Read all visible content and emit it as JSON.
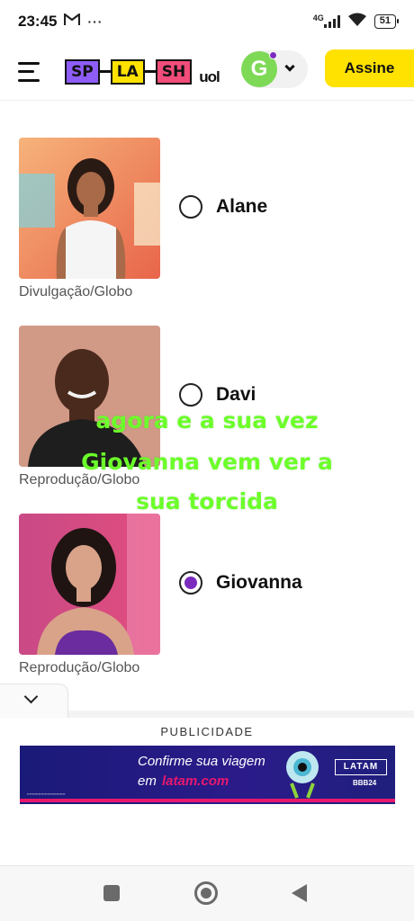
{
  "status_bar": {
    "time": "23:45",
    "notification_icons": [
      "gmail-icon",
      "more-dots-icon"
    ],
    "dots": "···",
    "network": "4G",
    "battery": "51"
  },
  "header": {
    "logo_blocks": [
      {
        "text": "SP",
        "color": "#8e5cf7"
      },
      {
        "text": "LA",
        "color": "#ffe200"
      },
      {
        "text": "SH",
        "color": "#f24c7a"
      }
    ],
    "logo_suffix": "uol",
    "avatar_initial": "G",
    "avatar_color": "#7ed957",
    "subscribe_label": "Assine"
  },
  "poll": {
    "options": [
      {
        "name": "Alane",
        "credit": "Divulgação/Globo",
        "selected": false
      },
      {
        "name": "Davi",
        "credit": "Reprodução/Globo",
        "selected": false
      },
      {
        "name": "Giovanna",
        "credit": "Reprodução/Globo",
        "selected": true
      }
    ],
    "selected_color": "#7b2cbf"
  },
  "overlay": {
    "lines": [
      "agora e a sua vez",
      "Giovanna vem ver a",
      "sua torcida"
    ],
    "color": "#6cff2a"
  },
  "ad": {
    "label": "PUBLICIDADE",
    "line1": "Confirme sua viagem",
    "line2_prefix": "em",
    "line2_link": "latam.com",
    "brand": "LATAM",
    "brand_sub": "BBB24"
  },
  "nav": {
    "icons": [
      "recent-apps-icon",
      "home-icon",
      "back-icon"
    ]
  }
}
